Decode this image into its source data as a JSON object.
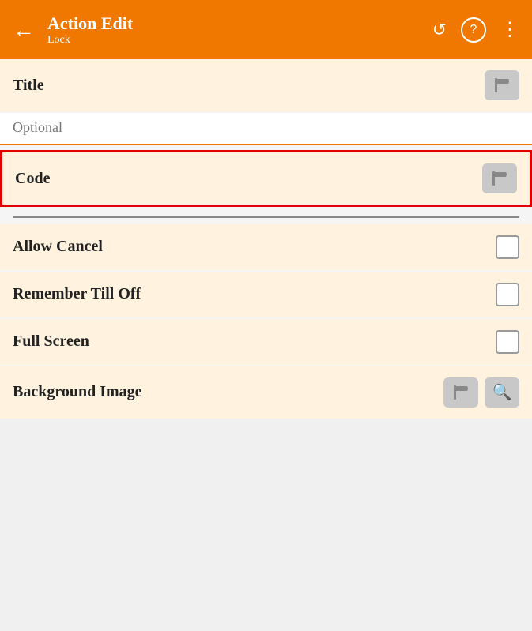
{
  "header": {
    "title": "Action Edit",
    "subtitle": "Lock",
    "back_label": "←",
    "reset_icon": "↺",
    "help_icon": "?",
    "more_icon": "⋮",
    "accent_color": "#f07800"
  },
  "fields": {
    "title_label": "Title",
    "optional_placeholder": "Optional",
    "code_label": "Code",
    "allow_cancel_label": "Allow Cancel",
    "remember_till_off_label": "Remember Till Off",
    "full_screen_label": "Full Screen",
    "background_image_label": "Background Image"
  },
  "icons": {
    "flag": "flag",
    "search": "🔍",
    "back_arrow": "←",
    "reset": "↺",
    "help": "?",
    "more": "⋮"
  }
}
